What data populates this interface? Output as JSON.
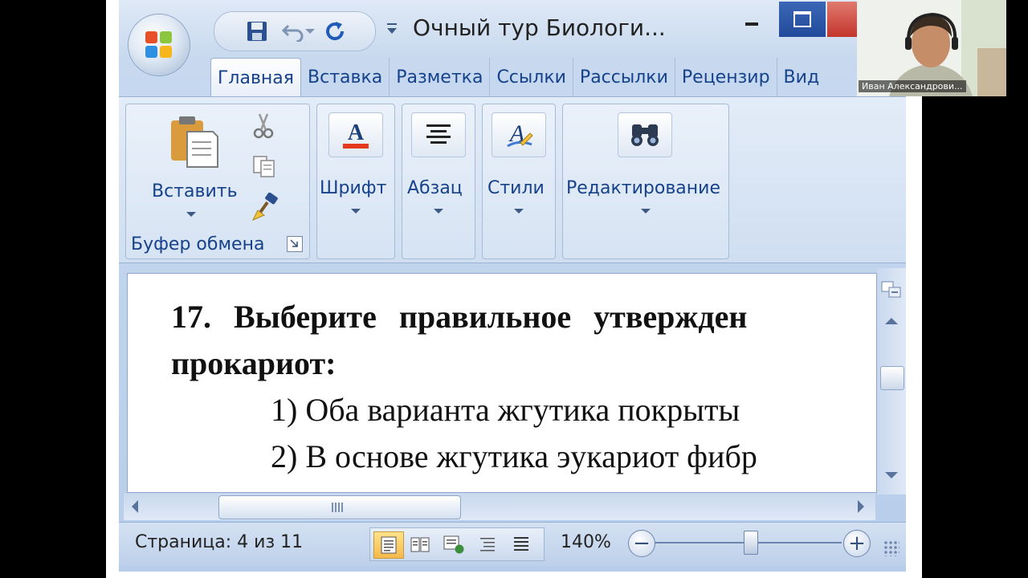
{
  "window": {
    "title": "Очный тур Биологи...",
    "minimize": "−"
  },
  "tabs": [
    {
      "label": "Главная",
      "active": true
    },
    {
      "label": "Вставка"
    },
    {
      "label": "Разметка"
    },
    {
      "label": "Ссылки"
    },
    {
      "label": "Рассылки"
    },
    {
      "label": "Рецензир"
    },
    {
      "label": "Вид"
    }
  ],
  "ribbon": {
    "paste": "Вставить",
    "clipboard": "Буфер обмена",
    "font": "Шрифт",
    "paragraph": "Абзац",
    "styles": "Стили",
    "editing": "Редактирование"
  },
  "document": {
    "lines": [
      "17. Выберите правильное утвержден",
      "прокариот:",
      "1) Оба варианта жгутика покрыты",
      "2) В основе жгутика эукариот фибр"
    ]
  },
  "status": {
    "page": "Страница: 4 из 11",
    "zoom": "140%",
    "zoom_level": 0.5
  },
  "participant": {
    "name": "Иван Александрови..."
  },
  "colors": {
    "accent": "#15428b",
    "close": "#c3352c",
    "maximize": "#214b9a"
  }
}
